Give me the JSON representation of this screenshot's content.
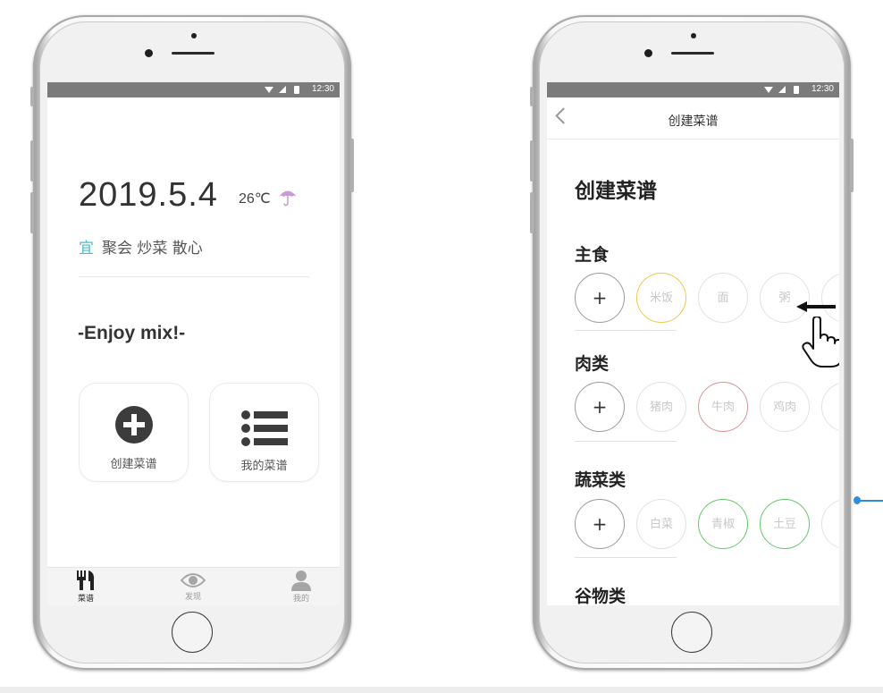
{
  "left_phone": {
    "status_time": "12:30",
    "date": "2019.5.4",
    "temperature": "26℃",
    "weather_icon": "umbrella-icon",
    "yi_label": "宜",
    "activities": "聚会 炒菜 散心",
    "slogan": "-Enjoy mix!-",
    "cards": [
      {
        "label": "创建菜谱",
        "icon": "plus-circle-icon"
      },
      {
        "label": "我的菜谱",
        "icon": "list-icon"
      }
    ],
    "tabs": [
      {
        "label": "菜谱",
        "icon": "fork-knife-icon",
        "active": true
      },
      {
        "label": "发现",
        "icon": "eye-icon",
        "active": false
      },
      {
        "label": "我的",
        "icon": "person-icon",
        "active": false
      }
    ]
  },
  "right_phone": {
    "status_time": "12:30",
    "nav_title": "创建菜谱",
    "page_heading": "创建菜谱",
    "sections": [
      {
        "title": "主食",
        "items": [
          {
            "label": "+",
            "style": "add"
          },
          {
            "label": "米饭",
            "style": "yellow"
          },
          {
            "label": "面",
            "style": "plain"
          },
          {
            "label": "粥",
            "style": "plain"
          }
        ]
      },
      {
        "title": "肉类",
        "items": [
          {
            "label": "+",
            "style": "add"
          },
          {
            "label": "猪肉",
            "style": "plain"
          },
          {
            "label": "牛肉",
            "style": "red"
          },
          {
            "label": "鸡肉",
            "style": "plain"
          }
        ]
      },
      {
        "title": "蔬菜类",
        "items": [
          {
            "label": "+",
            "style": "add"
          },
          {
            "label": "白菜",
            "style": "plain"
          },
          {
            "label": "青椒",
            "style": "green"
          },
          {
            "label": "土豆",
            "style": "green"
          }
        ]
      },
      {
        "title": "谷物类",
        "items": []
      }
    ]
  },
  "colors": {
    "accent_teal": "#4bbec8",
    "selected_yellow": "#f1c54b",
    "selected_red": "#d79494",
    "selected_green": "#62c96a",
    "annotation_blue": "#2f8ed9"
  }
}
